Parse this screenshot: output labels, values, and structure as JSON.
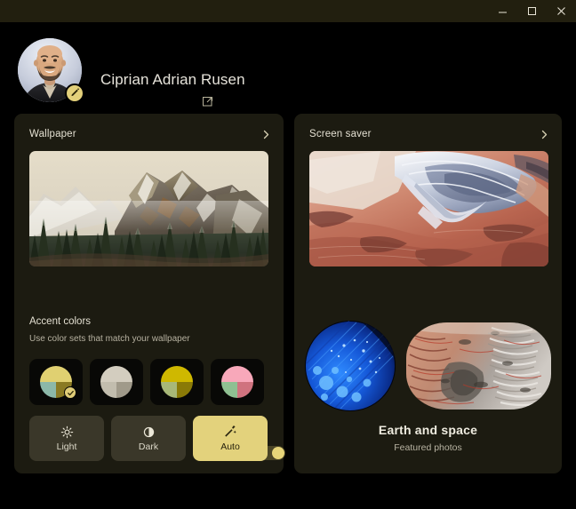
{
  "window": {
    "titlebar_color": "#221f0f",
    "controls": [
      {
        "name": "minimize",
        "label": "Minimize"
      },
      {
        "name": "maximize",
        "label": "Maximize"
      },
      {
        "name": "close",
        "label": "Close"
      }
    ]
  },
  "account": {
    "name": "Ciprian Adrian Rusen",
    "avatar_alt": "User profile photo",
    "edit_icon": "pencil-icon",
    "link_icon": "external-link-icon"
  },
  "wallpaper_card": {
    "title": "Wallpaper",
    "chevron": "chevron-right-icon",
    "preview_alt": "Snowy mountain peak above evergreen forest",
    "accent": {
      "title": "Accent colors",
      "subtitle": "Use color sets that match your wallpaper",
      "toggle_on": true,
      "toggle_color": "#e6d479",
      "swatches": [
        {
          "name": "swatch-1",
          "selected": true,
          "top": "#e0d071",
          "bottom_left": "#8cb8a9",
          "bottom_right": "#8a7a24"
        },
        {
          "name": "swatch-2",
          "selected": false,
          "top": "#d3cdbf",
          "bottom_left": "#c2bdae",
          "bottom_right": "#a09a8a"
        },
        {
          "name": "swatch-3",
          "selected": false,
          "top": "#cfb800",
          "bottom_left": "#a8b878",
          "bottom_right": "#8a7a07"
        },
        {
          "name": "swatch-4",
          "selected": false,
          "top": "#f8a8ba",
          "bottom_left": "#8fc092",
          "bottom_right": "#d0737f"
        }
      ],
      "themes": [
        {
          "name": "light",
          "label": "Light",
          "icon": "sun-icon",
          "active": false
        },
        {
          "name": "dark",
          "label": "Dark",
          "icon": "half-moon-icon",
          "active": false
        },
        {
          "name": "auto",
          "label": "Auto",
          "icon": "magic-wand-icon",
          "active": true
        }
      ],
      "active_color": "#e3d27c"
    }
  },
  "screensaver_card": {
    "title": "Screen saver",
    "chevron": "chevron-right-icon",
    "preview_alt": "Aerial satellite view of red desert terrain with pale blue ice formation",
    "thumb_a_alt": "Blue bokeh light abstract",
    "thumb_b_alt": "Aerial view of striated red and gray terrain",
    "caption": "Earth and space",
    "subcaption": "Featured photos"
  }
}
